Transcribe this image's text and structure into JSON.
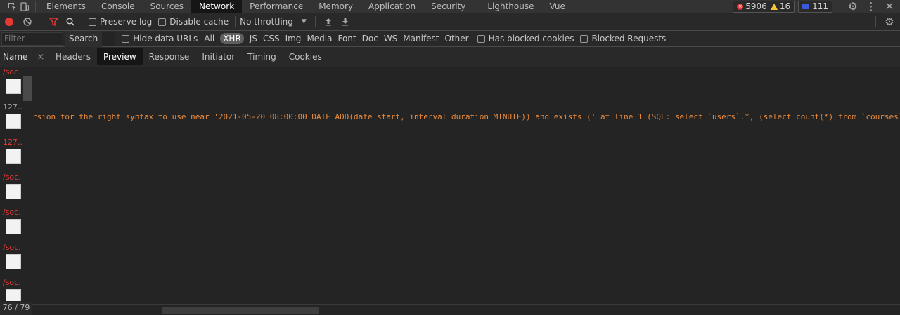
{
  "topbar": {
    "tabs": [
      {
        "label": "Elements",
        "active": false
      },
      {
        "label": "Console",
        "active": false
      },
      {
        "label": "Sources",
        "active": false
      },
      {
        "label": "Network",
        "active": true
      },
      {
        "label": "Performance",
        "active": false
      },
      {
        "label": "Memory",
        "active": false
      },
      {
        "label": "Application",
        "active": false
      },
      {
        "label": "Security",
        "active": false
      },
      {
        "label": "Lighthouse",
        "active": false
      },
      {
        "label": "Vue",
        "active": false
      }
    ],
    "errors_count": "5906",
    "warnings_count": "16",
    "info_count": "111",
    "icons": [
      "inspect-icon",
      "device-toggle-icon",
      "settings-icon",
      "kebab-menu-icon",
      "close-icon"
    ]
  },
  "toolbar": {
    "preserve_log": "Preserve log",
    "disable_cache": "Disable cache",
    "throttling": "No throttling",
    "icons": [
      "record-icon",
      "clear-icon",
      "filter-icon",
      "search-icon",
      "upload-icon",
      "download-icon",
      "settings-icon"
    ]
  },
  "filterbar": {
    "filter_placeholder": "Filter",
    "search_label": "Search",
    "hide_data_urls": "Hide data URLs",
    "types": [
      "All",
      "XHR",
      "JS",
      "CSS",
      "Img",
      "Media",
      "Font",
      "Doc",
      "WS",
      "Manifest",
      "Other"
    ],
    "active_type": "XHR",
    "has_blocked_cookies": "Has blocked cookies",
    "blocked_requests": "Blocked Requests"
  },
  "requests": {
    "header": "Name",
    "items": [
      {
        "name": "/soc...",
        "color": "#e53935"
      },
      {
        "name": "127....",
        "color": "#9e9e9e"
      },
      {
        "name": "127....",
        "color": "#e53935"
      },
      {
        "name": "/soc...",
        "color": "#e53935"
      },
      {
        "name": "/soc...",
        "color": "#e53935"
      },
      {
        "name": "/soc...",
        "color": "#e53935"
      },
      {
        "name": "/soc...",
        "color": "#e53935"
      }
    ],
    "count": "76 / 79"
  },
  "detail": {
    "close_glyph": "×",
    "tabs": [
      {
        "label": "Headers",
        "active": false
      },
      {
        "label": "Preview",
        "active": true
      },
      {
        "label": "Response",
        "active": false
      },
      {
        "label": "Initiator",
        "active": false
      },
      {
        "label": "Timing",
        "active": false
      },
      {
        "label": "Cookies",
        "active": false
      }
    ]
  },
  "preview": {
    "error_text": "rsion for the right syntax to use near '2021-05-20 08:00:00 DATE_ADD(date_start, interval duration MINUTE)) and exists (' at line 1 (SQL: select `users`.*, (select count(*) from `courses` where `user"
  },
  "colors": {
    "error": "#e53935",
    "warning": "#f9c431",
    "info": "#3b5bdb",
    "error_text": "#e98a3c",
    "filter_active": "#e53935"
  }
}
